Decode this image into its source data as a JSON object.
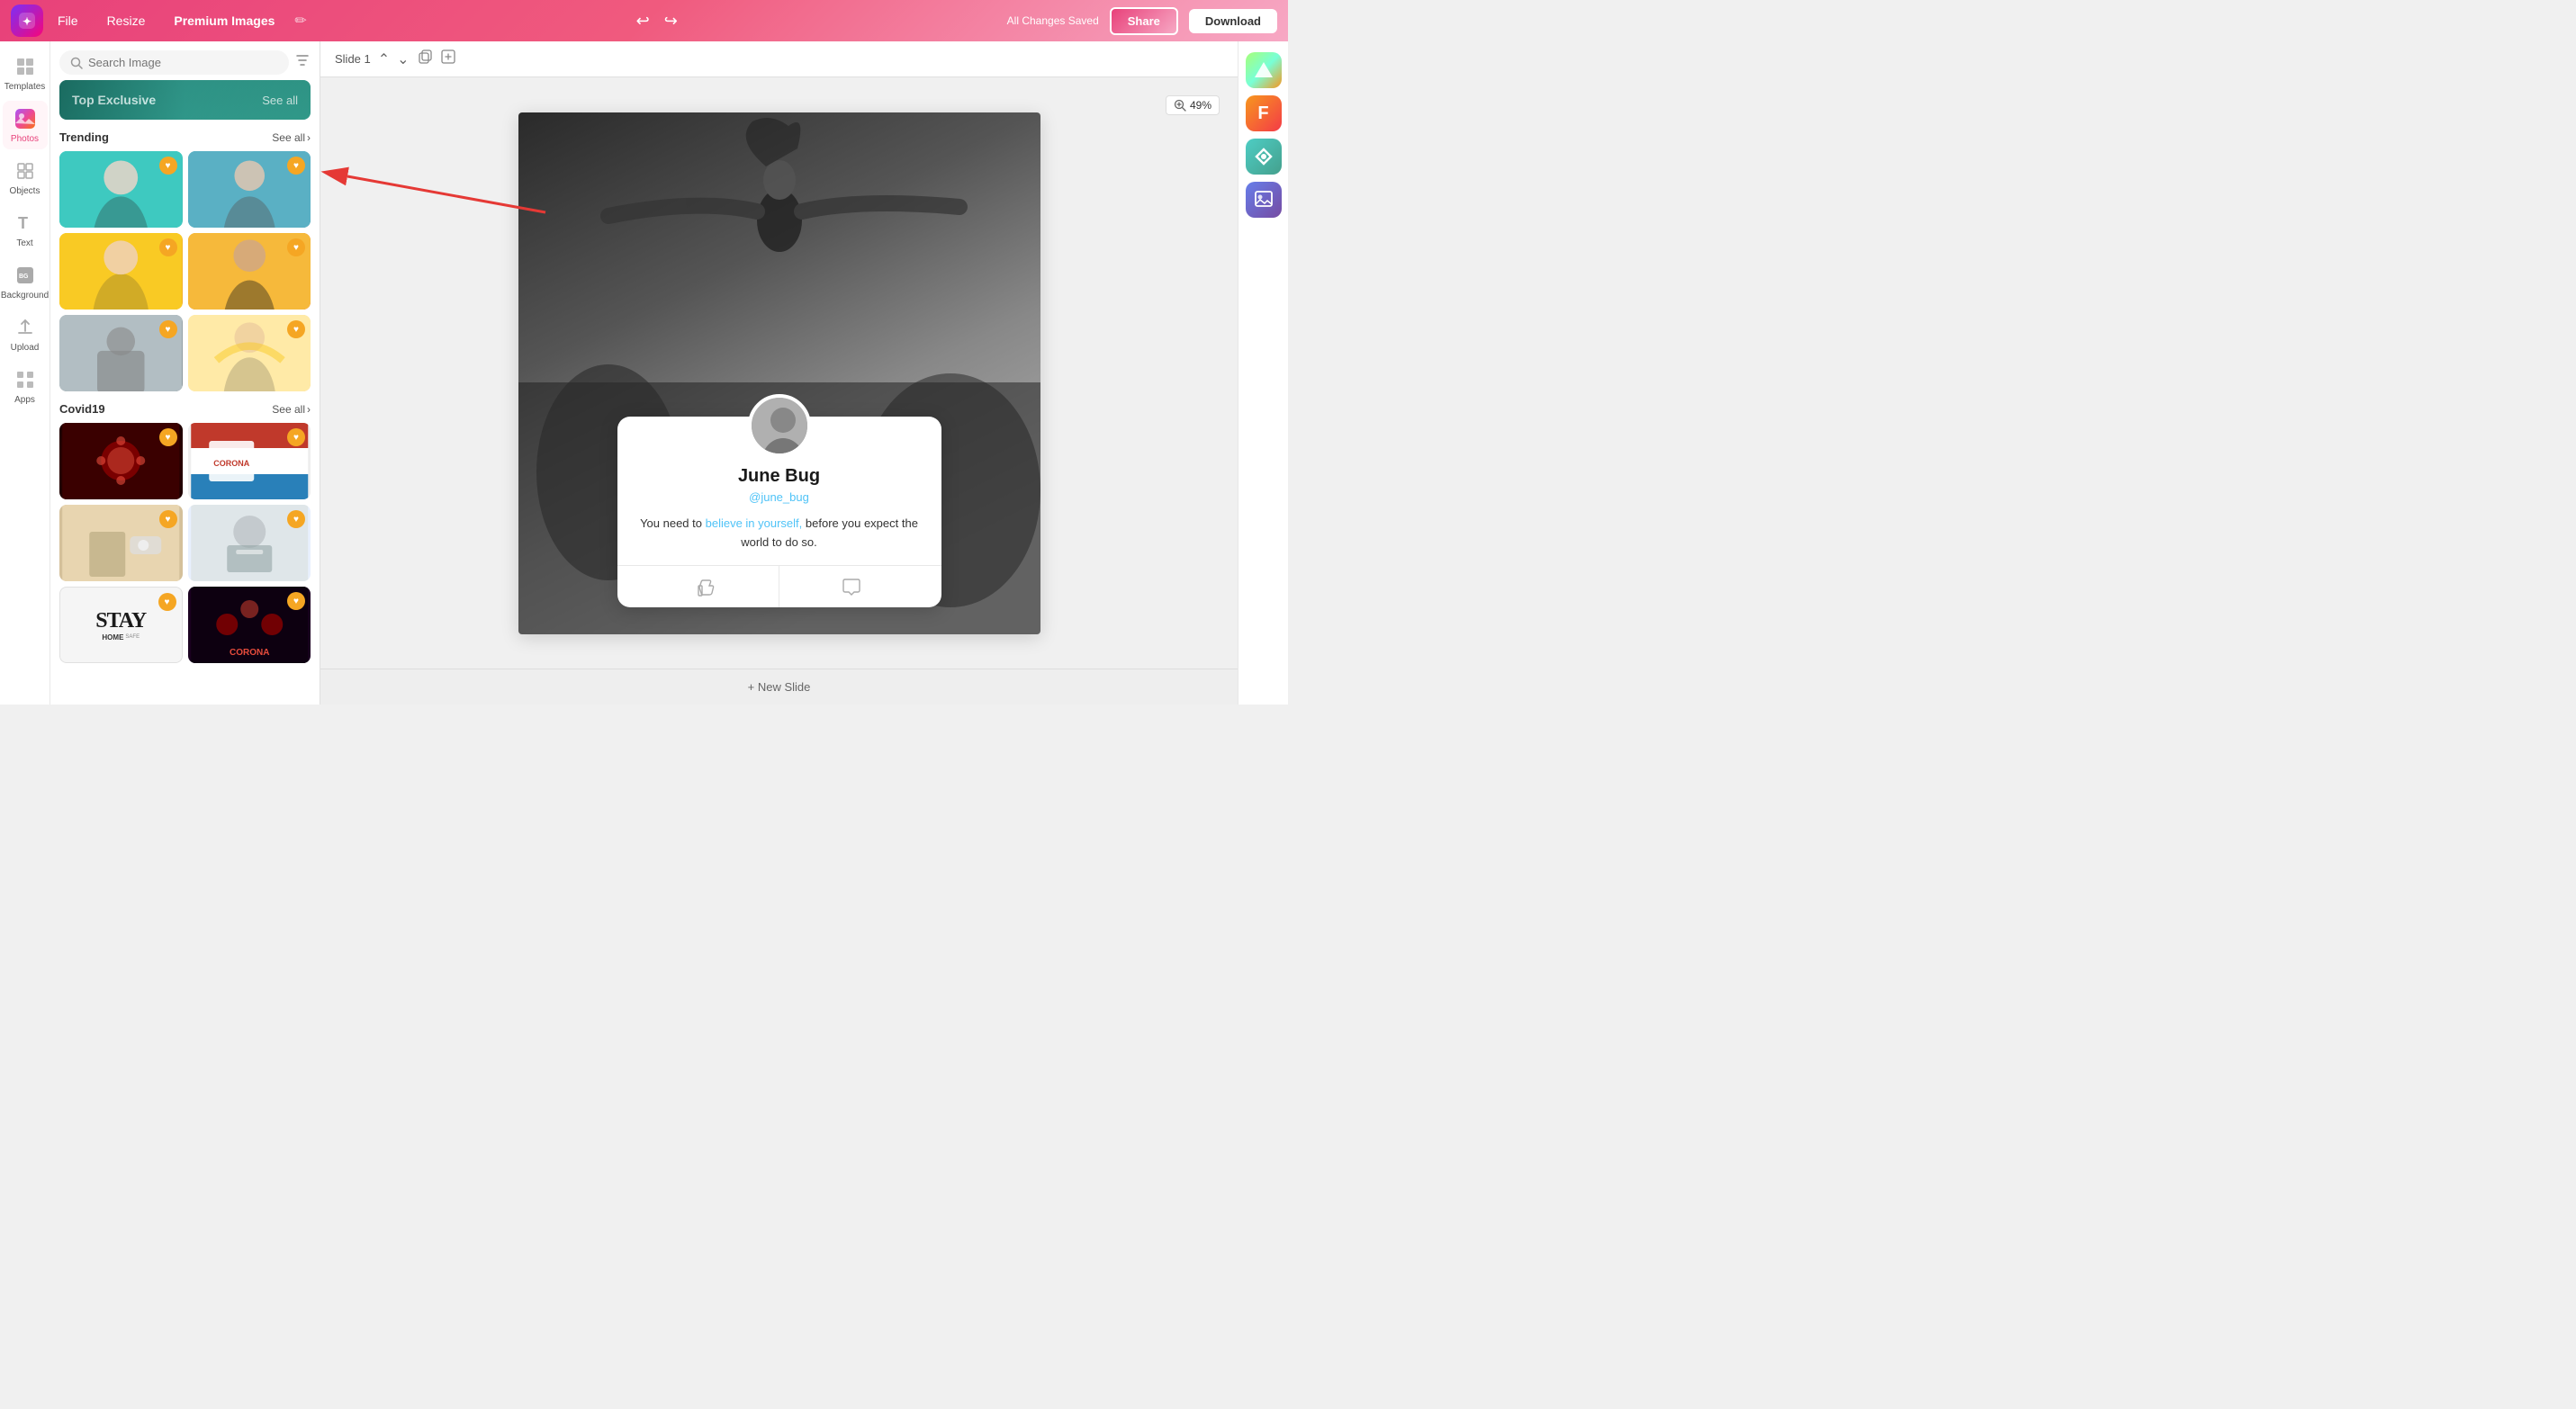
{
  "header": {
    "logo_text": "✦",
    "menu": [
      "File",
      "Resize",
      "Premium Images"
    ],
    "edit_icon": "✏",
    "title": "Premium Images",
    "undo_icon": "↩",
    "redo_icon": "↪",
    "saved_label": "All Changes Saved",
    "share_label": "Share",
    "download_label": "Download"
  },
  "sidebar": {
    "items": [
      {
        "id": "templates",
        "icon": "⊞",
        "label": "Templates"
      },
      {
        "id": "photos",
        "icon": "🖼",
        "label": "Photos"
      },
      {
        "id": "objects",
        "icon": "◻",
        "label": "Objects"
      },
      {
        "id": "text",
        "icon": "T",
        "label": "Text"
      },
      {
        "id": "background",
        "icon": "BG",
        "label": "Background"
      },
      {
        "id": "upload",
        "icon": "⬆",
        "label": "Upload"
      },
      {
        "id": "apps",
        "icon": "⊡",
        "label": "Apps"
      }
    ]
  },
  "panel": {
    "search_placeholder": "Search Image",
    "exclusive_label": "Top Exclusive",
    "exclusive_see_all": "See all",
    "sections": [
      {
        "id": "trending",
        "title": "Trending",
        "see_all": "See all",
        "images": [
          {
            "id": "t1",
            "class": "img-teal",
            "alt": "Woman surprised teal"
          },
          {
            "id": "t2",
            "class": "img-teal2",
            "alt": "Man surprised teal"
          },
          {
            "id": "t3",
            "class": "img-yellow",
            "alt": "Woman yellow"
          },
          {
            "id": "t4",
            "class": "img-yellow2",
            "alt": "Man screaming yellow"
          },
          {
            "id": "t5",
            "class": "img-gray",
            "alt": "Person sitting"
          },
          {
            "id": "t6",
            "class": "img-yellow3",
            "alt": "Woman hair flying"
          }
        ]
      },
      {
        "id": "covid19",
        "title": "Covid19",
        "see_all": "See all",
        "images": [
          {
            "id": "c1",
            "class": "img-red-dark",
            "alt": "Virus"
          },
          {
            "id": "c2",
            "class": "img-flag",
            "alt": "Coronavirus flag"
          },
          {
            "id": "c3",
            "class": "img-hand",
            "alt": "Hands sanitizer"
          },
          {
            "id": "c4",
            "class": "img-hospital",
            "alt": "Hospital worker"
          },
          {
            "id": "c5",
            "class": "img-stay",
            "alt": "Stay text"
          },
          {
            "id": "c6",
            "class": "img-corona",
            "alt": "Corona cells"
          }
        ]
      }
    ]
  },
  "slide": {
    "label": "Slide 1",
    "zoom": "49%",
    "new_slide_label": "+ New Slide"
  },
  "card": {
    "name": "June Bug",
    "handle": "@june_bug",
    "quote_normal1": "You need to ",
    "quote_highlight": "believe in yourself,",
    "quote_normal2": " before you expect the world to do so.",
    "like_icon": "👍",
    "comment_icon": "💬"
  },
  "right_sidebar": {
    "apps": [
      {
        "id": "app1",
        "class": "app-gradient-1",
        "icon": "▲"
      },
      {
        "id": "app2",
        "class": "app-gradient-2",
        "icon": "F"
      },
      {
        "id": "app3",
        "class": "app-gradient-3",
        "icon": "◆"
      },
      {
        "id": "app4",
        "class": "app-gradient-4",
        "icon": "🖼"
      }
    ]
  }
}
